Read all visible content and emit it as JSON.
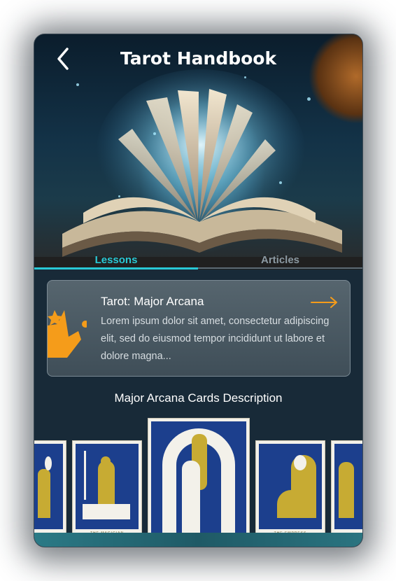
{
  "header": {
    "title": "Tarot Handbook",
    "back_icon": "chevron-left-icon"
  },
  "tabs": [
    {
      "label": "Lessons",
      "active": true
    },
    {
      "label": "Articles",
      "active": false
    }
  ],
  "lesson_card": {
    "title": "Tarot: Major Arcana",
    "body": "Lorem ipsum dolor sit amet, consectetur adipiscing elit, sed do eiusmod tempor incididunt ut labore et dolore magna...",
    "icon": "crown-icon",
    "arrow_icon": "arrow-right-icon"
  },
  "section": {
    "title": "Major Arcana Cards Description"
  },
  "cards": [
    {
      "caption": ""
    },
    {
      "caption": "THE MAGICIAN"
    },
    {
      "caption": ""
    },
    {
      "caption": "THE EMPRESS"
    },
    {
      "caption": ""
    }
  ],
  "colors": {
    "accent": "#29c9d6",
    "crown": "#f59c1a",
    "background": "#182a38",
    "card_blue": "#1c3f8d",
    "card_gold": "#c7ab33"
  }
}
